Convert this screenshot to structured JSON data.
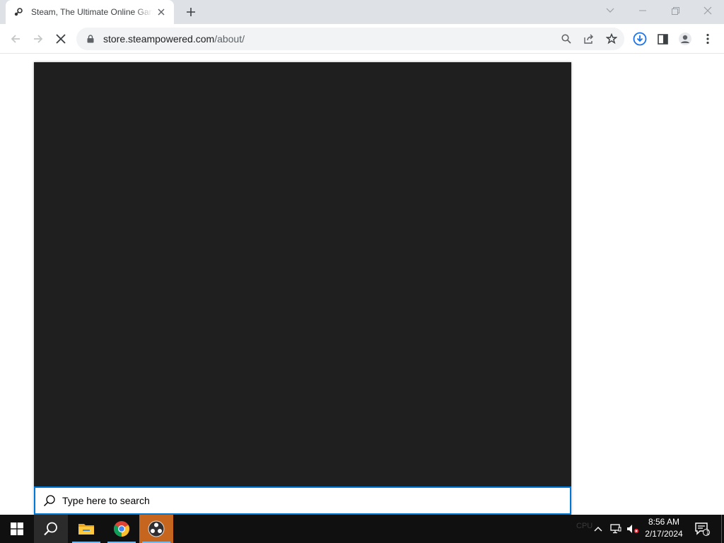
{
  "browser": {
    "tab": {
      "title": "Steam, The Ultimate Online Game Platform",
      "favicon": "steam-icon",
      "close_icon": "close-icon"
    },
    "new_tab_icon": "plus-icon",
    "window_controls": [
      "chevron-down-icon",
      "minimize-icon",
      "restore-icon",
      "close-icon"
    ],
    "toolbar": {
      "back_icon": "back-arrow-icon",
      "forward_icon": "forward-arrow-icon",
      "stop_icon": "stop-icon",
      "lock_icon": "lock-icon",
      "url_host": "store.steampowered.com",
      "url_path": "/about/",
      "right_icons": [
        "search-icon",
        "share-icon",
        "star-icon",
        "download-icon",
        "side-panel-icon",
        "profile-icon",
        "more-menu-icon"
      ]
    }
  },
  "start_search": {
    "panel_color": "#1f1f1f",
    "placeholder": "Type here to search",
    "value": "",
    "border_color": "#0078d7"
  },
  "taskbar": {
    "apps": [
      "windows-start-icon",
      "search-icon",
      "file-explorer-icon",
      "chrome-icon",
      "obs-icon"
    ],
    "faint_widgets": [
      "CPU"
    ],
    "tray_icons": [
      "chevron-up-icon",
      "network-icon",
      "volume-muted-icon",
      "notification-icon"
    ],
    "time": "8:56 AM",
    "date": "2/17/2024",
    "notification_count": "1"
  },
  "colors": {
    "accent": "#0078d7",
    "taskbar": "#101010",
    "obs_highlight": "#c5651e",
    "tab_strip": "#dee1e6",
    "download_blue": "#1a73e8"
  }
}
